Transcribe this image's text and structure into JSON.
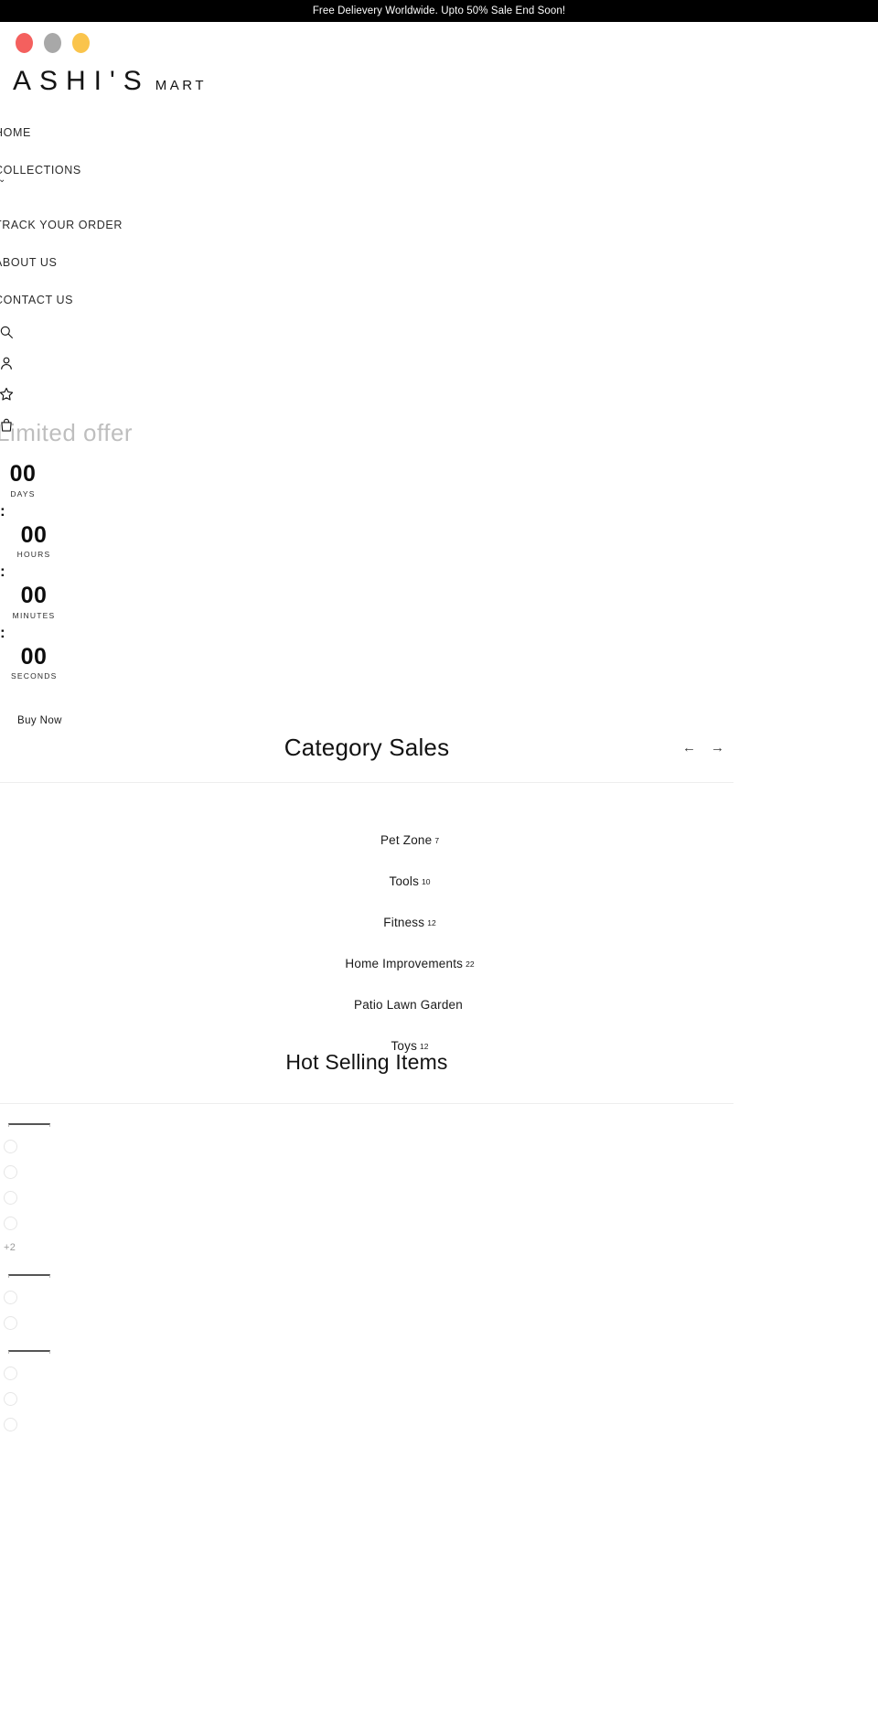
{
  "promo": {
    "text": "Free Delievery Worldwide. Upto 50% Sale End Soon!",
    "background": "#000000",
    "color": "#ffffff"
  },
  "logo": {
    "main": "ASHI'S",
    "sub": "MART",
    "dots": [
      {
        "name": "dot-red",
        "color": "#f4605e"
      },
      {
        "name": "dot-gray",
        "color": "#a8a8a8"
      },
      {
        "name": "dot-yellow",
        "color": "#fcc councils"
      }
    ],
    "dot_colors": [
      "#f4605e",
      "#a8a8a8",
      "#fac44c"
    ]
  },
  "nav": {
    "items": [
      {
        "label": "HOME",
        "caret": false
      },
      {
        "label": "COLLECTIONS",
        "caret": true,
        "caret_glyph": "⌄"
      },
      {
        "label": "TRACK YOUR ORDER",
        "caret": false
      },
      {
        "label": "ABOUT US",
        "caret": false
      },
      {
        "label": "CONTACT US",
        "caret": false
      }
    ]
  },
  "icon_rail": [
    {
      "name": "search-icon"
    },
    {
      "name": "user-account-icon"
    },
    {
      "name": "wishlist-star-icon"
    },
    {
      "name": "shopping-bag-icon"
    }
  ],
  "hero": {
    "title": "Limited offer",
    "buy_now": "Buy Now"
  },
  "countdown": {
    "separator": ":",
    "units": [
      {
        "value": "00",
        "label": "DAYS"
      },
      {
        "value": "00",
        "label": "HOURS"
      },
      {
        "value": "00",
        "label": "MINUTES"
      },
      {
        "value": "00",
        "label": "SECONDS"
      }
    ]
  },
  "category_section": {
    "title": "Category Sales",
    "prev_arrow": "←",
    "next_arrow": "→",
    "categories": [
      {
        "name": "Pet Zone",
        "count": "7"
      },
      {
        "name": "Tools",
        "count": "10"
      },
      {
        "name": "Fitness",
        "count": "12"
      },
      {
        "name": "Home Improvements",
        "count": "22"
      },
      {
        "name": "Patio Lawn Garden",
        "count": ""
      },
      {
        "name": "Toys",
        "count": "12"
      }
    ]
  },
  "hot_selling": {
    "title": "Hot Selling Items",
    "groups": [
      {
        "swatches": 4,
        "more": "+2"
      },
      {
        "swatches": 2,
        "more": ""
      },
      {
        "swatches": 3,
        "more": ""
      }
    ]
  }
}
